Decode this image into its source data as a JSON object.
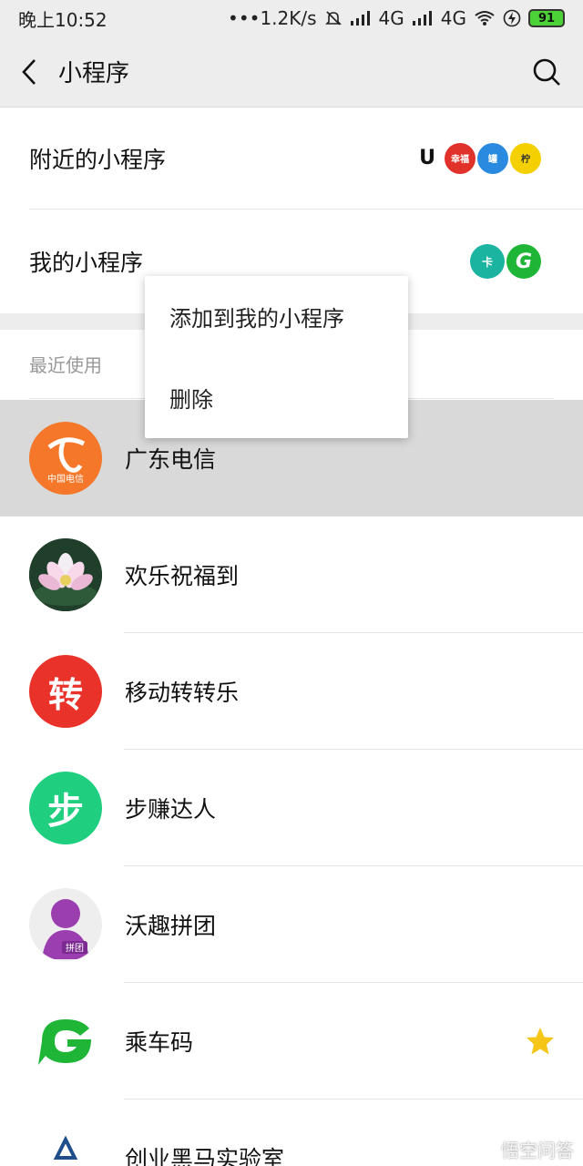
{
  "status": {
    "time": "晚上10:52",
    "network_speed": "•••1.2K/s",
    "signal1": "4G",
    "signal2": "4G",
    "battery": "91"
  },
  "nav": {
    "title": "小程序"
  },
  "sections": {
    "nearby_label": "附近的小程序",
    "nearby_thumbs": [
      "U",
      "幸福",
      "罐",
      "柠"
    ],
    "mine_label": "我的小程序",
    "mine_thumbs": [
      "卡",
      "G"
    ],
    "recent_header": "最近使用"
  },
  "recent": [
    {
      "name": "广东电信",
      "icon": "china-telecom-icon"
    },
    {
      "name": "欢乐祝福到",
      "icon": "lotus-icon"
    },
    {
      "name": "移动转转乐",
      "icon": "zhuan-icon"
    },
    {
      "name": "步赚达人",
      "icon": "bu-icon"
    },
    {
      "name": "沃趣拼团",
      "icon": "woqu-icon"
    },
    {
      "name": "乘车码",
      "icon": "bus-code-icon",
      "starred": true
    },
    {
      "name": "创业黑马实验室",
      "icon": "heima-icon"
    }
  ],
  "icon_text": {
    "telecom": "中国电信",
    "zhuan": "转",
    "bu": "步",
    "woqu": "拼团"
  },
  "context_menu": {
    "add": "添加到我的小程序",
    "delete": "删除"
  },
  "watermark": "悟空问答",
  "colors": {
    "telecom": "#f4772a",
    "zhuan": "#e8322a",
    "bu": "#1fcf7f",
    "woqu": "#9b3fb0",
    "bus": "#1fb637",
    "star": "#f5c518"
  }
}
